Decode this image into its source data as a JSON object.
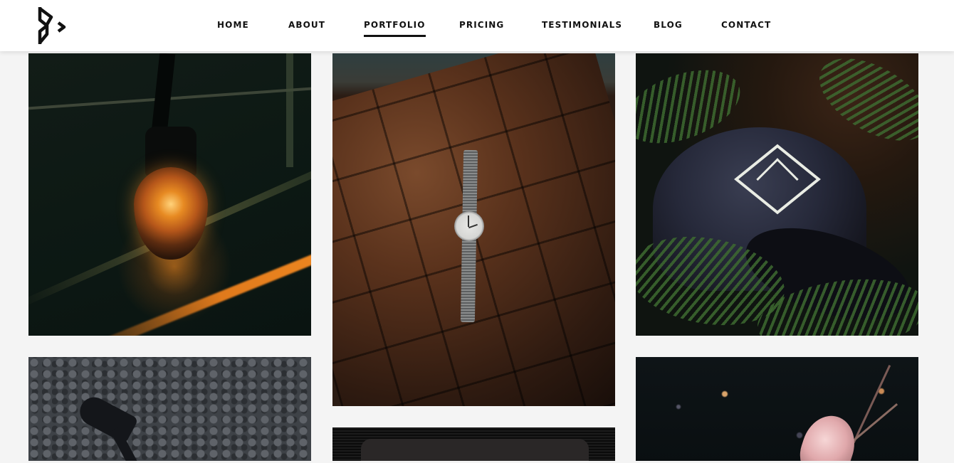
{
  "header": {
    "logo_icon": "brand-logo-icon",
    "nav": {
      "items": [
        {
          "label": "HOME",
          "active": false
        },
        {
          "label": "ABOUT",
          "active": false
        },
        {
          "label": "PORTFOLIO",
          "active": true
        },
        {
          "label": "PRICING",
          "active": false
        },
        {
          "label": "TESTIMONIALS",
          "active": false
        },
        {
          "label": "BLOG",
          "active": false
        },
        {
          "label": "CONTACT",
          "active": false
        }
      ]
    }
  },
  "portfolio": {
    "tiles": [
      {
        "subject": "light-bulb"
      },
      {
        "subject": "wristwatch-on-leather"
      },
      {
        "subject": "cap-in-ferns"
      },
      {
        "subject": "lamp-on-gravel"
      },
      {
        "subject": "dark-object"
      },
      {
        "subject": "feather-on-ground"
      }
    ]
  },
  "colors": {
    "header_bg": "#ffffff",
    "page_bg": "#f4f4f4",
    "nav_text": "#111111",
    "active_underline": "#111111"
  }
}
